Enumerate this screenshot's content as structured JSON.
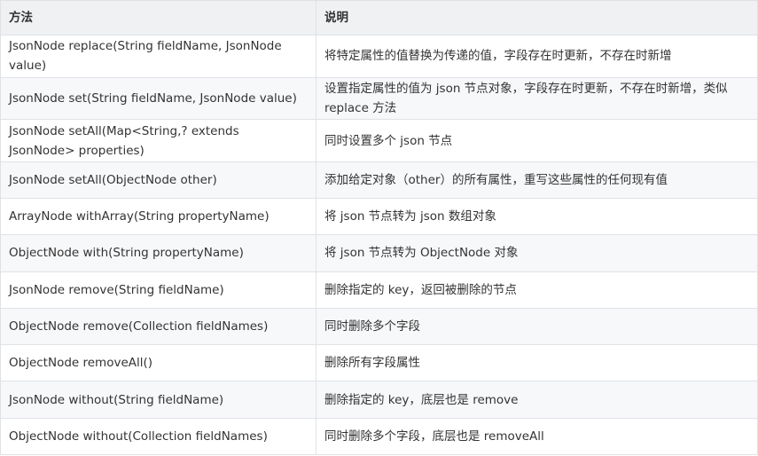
{
  "table": {
    "headers": [
      "方法",
      "说明"
    ],
    "rows": [
      [
        "JsonNode replace(String fieldName, JsonNode value)",
        "将特定属性的值替换为传递的值，字段存在时更新，不存在时新增"
      ],
      [
        "JsonNode set(String fieldName, JsonNode value)",
        "设置指定属性的值为 json 节点对象，字段存在时更新，不存在时新增，类似 replace 方法"
      ],
      [
        "JsonNode setAll(Map<String,? extends JsonNode> properties)",
        "同时设置多个 json 节点"
      ],
      [
        "JsonNode setAll(ObjectNode other)",
        "添加给定对象（other）的所有属性，重写这些属性的任何现有值"
      ],
      [
        "ArrayNode withArray(String propertyName)",
        "将 json 节点转为 json 数组对象"
      ],
      [
        "ObjectNode with(String propertyName)",
        "将 json 节点转为 ObjectNode 对象"
      ],
      [
        "JsonNode remove(String fieldName)",
        "删除指定的 key，返回被删除的节点"
      ],
      [
        "ObjectNode remove(Collection fieldNames)",
        "同时删除多个字段"
      ],
      [
        "ObjectNode removeAll()",
        "删除所有字段属性"
      ],
      [
        "JsonNode without(String fieldName)",
        "删除指定的 key，底层也是 remove"
      ],
      [
        "ObjectNode without(Collection fieldNames)",
        "同时删除多个字段，底层也是 removeAll"
      ]
    ]
  }
}
